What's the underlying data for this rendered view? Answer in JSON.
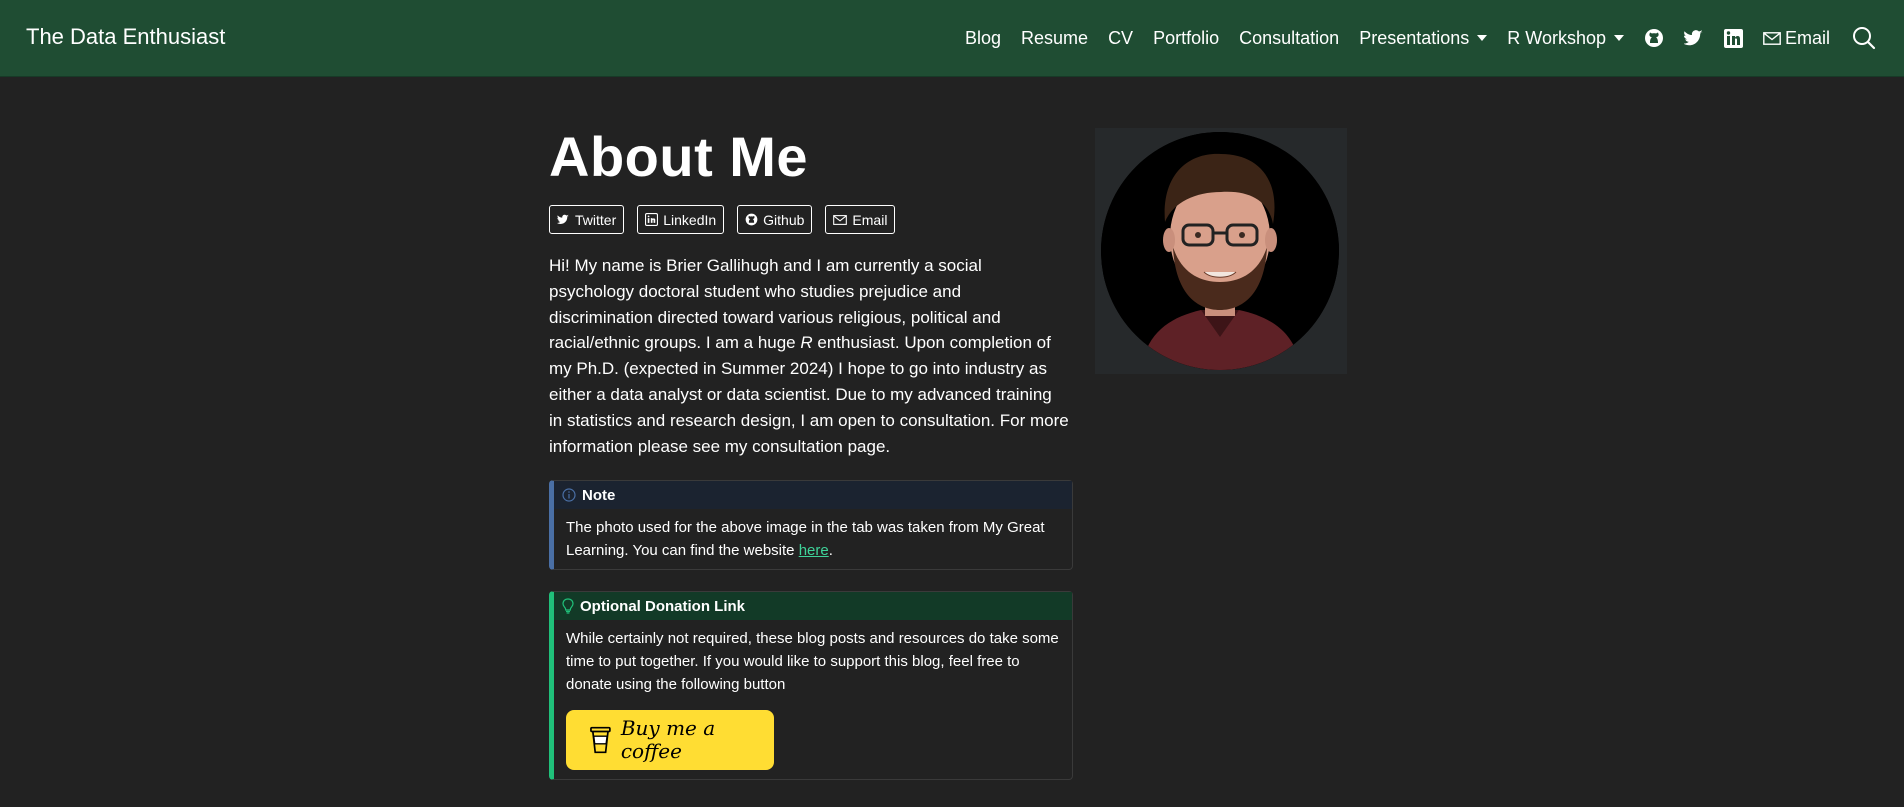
{
  "brand": "The Data Enthusiast",
  "nav": {
    "blog": "Blog",
    "resume": "Resume",
    "cv": "CV",
    "portfolio": "Portfolio",
    "consultation": "Consultation",
    "presentations": "Presentations",
    "r_workshop": "R Workshop",
    "email": "Email"
  },
  "page": {
    "title": "About Me",
    "social": {
      "twitter": "Twitter",
      "linkedin": "LinkedIn",
      "github": "Github",
      "email": "Email"
    },
    "intro": {
      "before_r": "Hi! My name is Brier Gallihugh and I am currently a social psychology doctoral student who studies prejudice and discrimination directed toward various religious, political and racial/ethnic groups. I am a huge ",
      "r": "R",
      "after_r": " enthusiast. Upon completion of my Ph.D. (expected in Summer 2024) I hope to go into industry as either a data analyst or data scientist. Due to my advanced training in statistics and research design, I am open to consultation. For more information please see my consultation page."
    },
    "note": {
      "title": "Note",
      "body_before": "The photo used for the above image in the tab was taken from My Great Learning. You can find the website ",
      "link": "here",
      "body_after": "."
    },
    "donation": {
      "title": "Optional Donation Link",
      "body": "While certainly not required, these blog posts and resources do take some time to put together. If you would like to support this blog, feel free to donate using the following button",
      "button": "Buy me a coffee"
    }
  },
  "colors": {
    "navbar": "#1f4d33",
    "background": "#222222",
    "link": "#3fd39a",
    "coffee": "#ffdd33"
  }
}
